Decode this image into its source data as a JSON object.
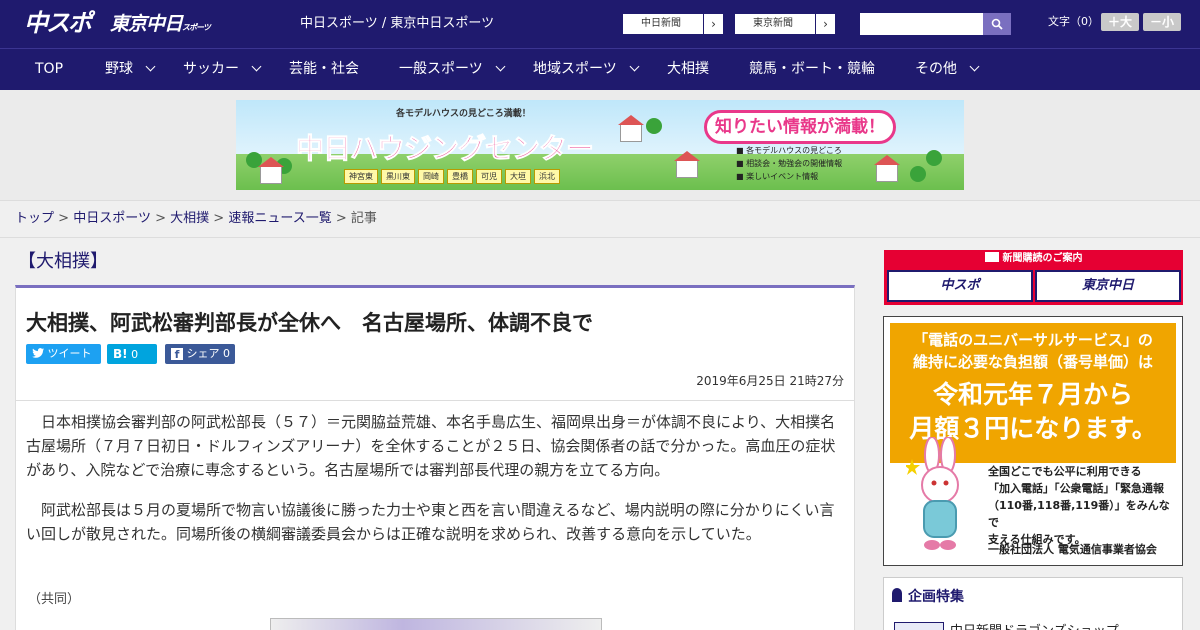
{
  "header": {
    "logo_primary": "中スポ",
    "logo_secondary": "東京中日",
    "logo_secondary_small": "スポーツ",
    "site_tagline": "中日スポーツ / 東京中日スポーツ",
    "ext_links": [
      "中日新聞",
      "東京新聞"
    ],
    "search": {
      "placeholder": "",
      "button_icon": "search-icon"
    },
    "font_size": {
      "label": "文字（0）",
      "increase": "＋大",
      "decrease": "－小"
    }
  },
  "nav": {
    "items": [
      {
        "label": "TOP",
        "dropdown": false
      },
      {
        "label": "野球",
        "dropdown": true
      },
      {
        "label": "サッカー",
        "dropdown": true
      },
      {
        "label": "芸能・社会",
        "dropdown": false
      },
      {
        "label": "一般スポーツ",
        "dropdown": true
      },
      {
        "label": "地域スポーツ",
        "dropdown": true
      },
      {
        "label": "大相撲",
        "dropdown": false
      },
      {
        "label": "競馬・ボート・競輪",
        "dropdown": false
      },
      {
        "label": "その他",
        "dropdown": true
      }
    ]
  },
  "banner": {
    "title": "中日ハウジングセンター",
    "subtitle": "各モデルハウスの見どころ満載！",
    "callout": "知りたい情報が満載！",
    "list": [
      "各モデルハウスの見どころ",
      "相談会・勉強会の開催情報",
      "楽しいイベント情報"
    ],
    "towns": [
      "神宮東",
      "黒川東",
      "岡崎",
      "豊橋",
      "可児",
      "大垣",
      "浜北"
    ]
  },
  "breadcrumb": {
    "items": [
      "トップ",
      "中日スポーツ",
      "大相撲",
      "速報ニュース一覧"
    ],
    "current": "記事",
    "separator": ">"
  },
  "article": {
    "category": "【大相撲】",
    "headline": "大相撲、阿武松審判部長が全休へ　名古屋場所、体調不良で",
    "share": {
      "tweet": "ツイート",
      "hatena": "0",
      "facebook": "シェア",
      "facebook_count": "0"
    },
    "date": "2019年6月25日 21時27分",
    "paragraphs": [
      "　日本相撲協会審判部の阿武松部長（５７）＝元関脇益荒雄、本名手島広生、福岡県出身＝が体調不良により、大相撲名古屋場所（７月７日初日・ドルフィンズアリーナ）を全休することが２５日、協会関係者の話で分かった。高血圧の症状があり、入院などで治療に専念するという。名古屋場所では審判部長代理の親方を立てる方向。",
      "　阿武松部長は５月の夏場所で物言い協議後に勝った力士や東と西を言い間違えるなど、場内説明の際に分かりにくい言い回しが散見された。同場所後の横綱審議委員会からは正確な説明を求められ、改善する意向を示していた。"
    ],
    "credit": "（共同）"
  },
  "sidebar": {
    "subscribe": {
      "title": "新聞購読のご案内",
      "brands": [
        "中スポ",
        "東京中日"
      ]
    },
    "universal_ad": {
      "line1": "「電話のユニバーサルサービス」の",
      "line2": "維持に必要な負担額（番号単価）は",
      "line3": "令和元年７月から",
      "line4": "月額３円になります。",
      "body": [
        "全国どこでも公平に利用できる",
        "「加入電話」「公衆電話」「緊急通報",
        "（110番,118番,119番）」をみんなで",
        "支える仕組みです。"
      ],
      "org": "一般社団法人 電気通信事業者協会"
    },
    "feature": {
      "title": "企画特集",
      "item": "中日新聞ドラゴンズショップ"
    }
  },
  "colors": {
    "brand_navy": "#1f1a6e",
    "accent_purple": "#7a6fc0",
    "twitter": "#1da1f2",
    "hatena": "#00a4de",
    "facebook": "#3b5998",
    "subscribe_red": "#e60033",
    "ad_orange": "#f0a500"
  }
}
